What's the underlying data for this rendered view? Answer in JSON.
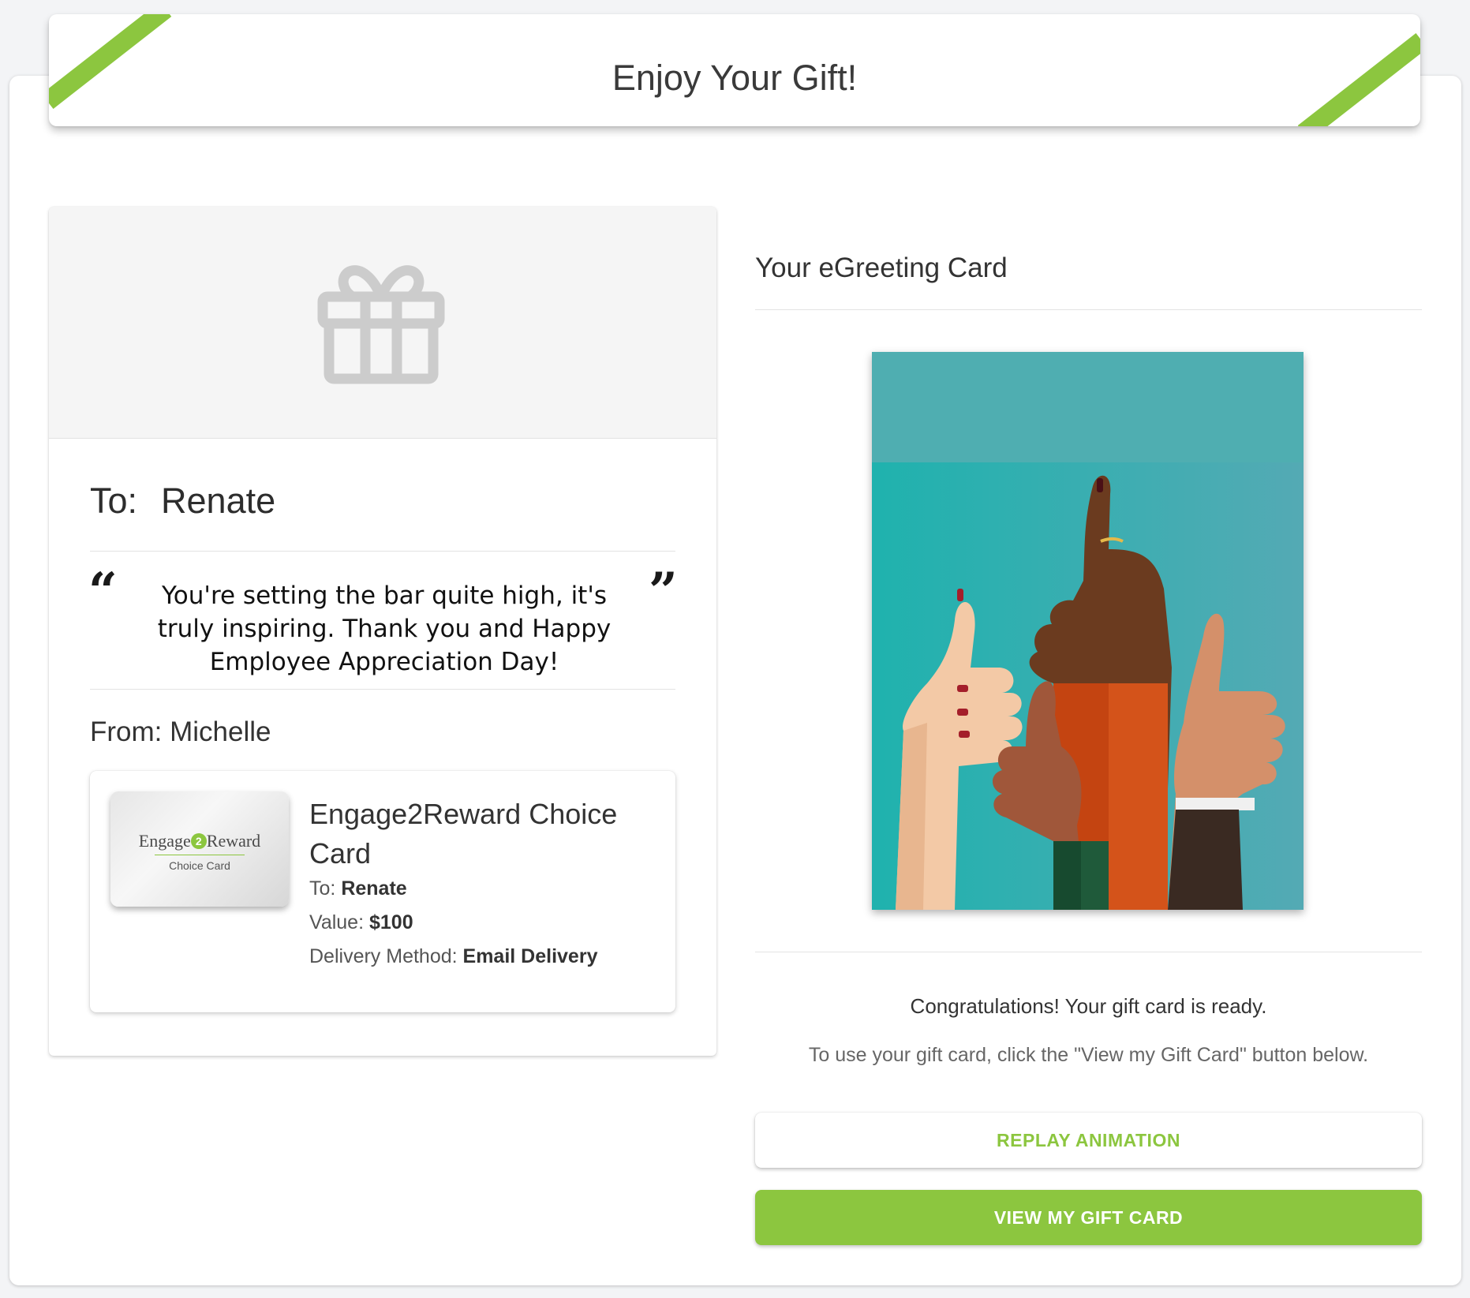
{
  "header": {
    "title": "Enjoy Your Gift!"
  },
  "colors": {
    "accent": "#8cc63f",
    "ecard_background": "#23b0ad"
  },
  "gift": {
    "icon": "gift-icon",
    "to_label": "To:",
    "to_name": "Renate",
    "message": "You're setting the bar quite high, it's truly inspiring. Thank you and Happy Employee Appreciation Day!",
    "quote_open": "“",
    "quote_close": "”",
    "from": "From: Michelle"
  },
  "product": {
    "card_brand_left": "Engage",
    "card_brand_mid": "2",
    "card_brand_right": "Reward",
    "card_subtitle": "Choice Card",
    "name": "Engage2Reward Choice Card",
    "to_label": "To:",
    "to_value": "Renate",
    "value_label": "Value:",
    "value": "$100",
    "delivery_label": "Delivery Method:",
    "delivery_value": "Email Delivery"
  },
  "egreeting": {
    "title": "Your eGreeting Card",
    "image": "thumbs-up-hands-illustration"
  },
  "footer": {
    "congrats": "Congratulations! Your gift card is ready.",
    "instructions": "To use your gift card, click the \"View my Gift Card\" button below."
  },
  "buttons": {
    "replay": "REPLAY ANIMATION",
    "view": "VIEW MY GIFT CARD"
  }
}
